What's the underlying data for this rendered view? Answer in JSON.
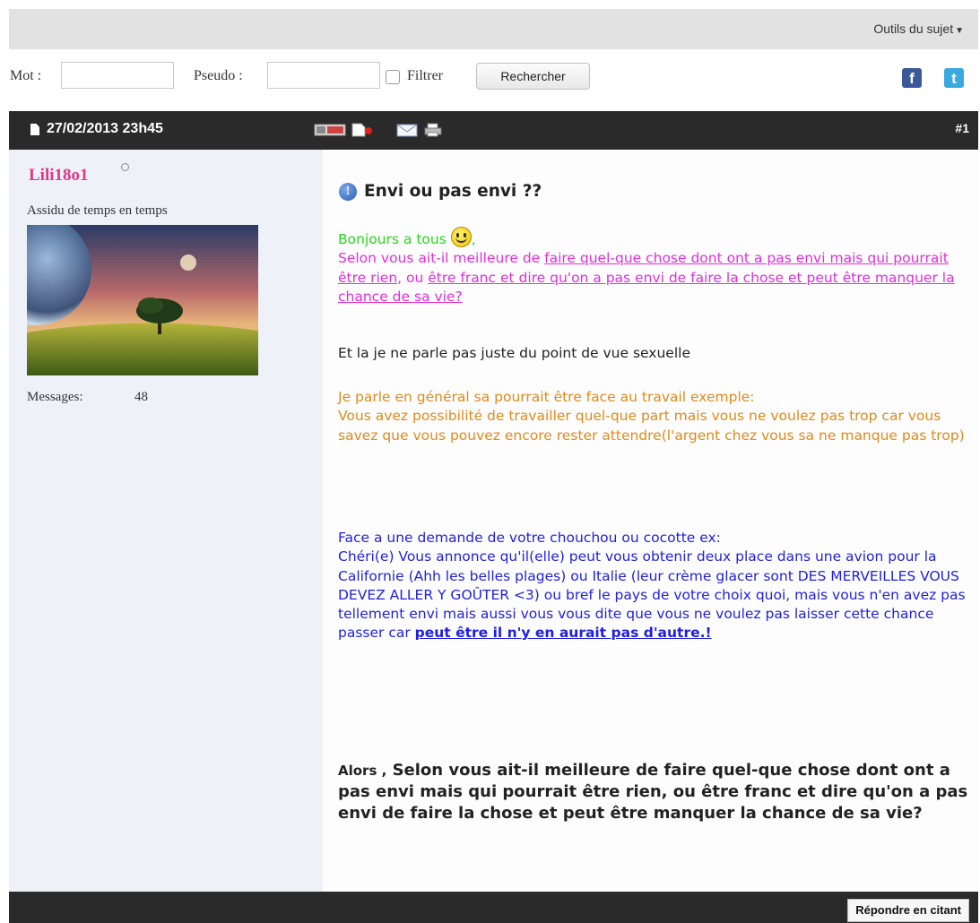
{
  "toolbar": {
    "tools_label": "Outils du sujet"
  },
  "search": {
    "word_label": "Mot :",
    "pseudo_label": "Pseudo :",
    "filter_label": "Filtrer",
    "search_button": "Rechercher"
  },
  "social": {
    "facebook": "f",
    "twitter": "t"
  },
  "post": {
    "date": "27/02/2013 23h45",
    "number": "#1",
    "author": {
      "name": "Lili18o1",
      "rank": "Assidu de temps en temps",
      "messages_label": "Messages:",
      "messages_count": "48"
    },
    "title": "Envi ou pas envi ??",
    "greeting": "Bonjours a tous",
    "greeting_suffix": ",",
    "q1_lead": "Selon vous ait-il meilleure de ",
    "q1_link1": "faire quel-que chose dont ont a pas envi mais qui pourrait être rien",
    "q1_mid": ", ou ",
    "q1_link2": "être franc et dire qu'on a pas envi de faire la chose et peut être manquer la chance de sa vie?",
    "not_sexual": "Et la je ne parle pas juste du point de vue sexuelle",
    "work_line1": "Je parle en général sa pourrait être face au travail exemple:",
    "work_line2": "Vous avez possibilité de travailler quel-que part mais vous ne voulez pas trop car vous savez que vous pouvez encore rester attendre(l'argent chez vous sa ne manque pas trop)",
    "partner_line1": "Face a une demande de votre chouchou ou cocotte ex:",
    "partner_line2": "Chéri(e) Vous annonce qu'il(elle) peut vous obtenir deux place dans une avion pour la Californie (Ahh les belles plages) ou Italie (leur crème glacer sont DES MERVEILLES VOUS DEVEZ ALLER Y GOÛTER <3) ou bref le pays de votre choix quoi, mais vous n'en avez pas tellement envi mais aussi vous vous dite que vous ne voulez pas laisser cette chance passer car ",
    "partner_link": "peut être il n'y en aurait pas d'autre.!",
    "final_lead": "Alors ,",
    "final_question": " Selon vous ait-il meilleure de faire quel-que chose dont ont a pas envi mais qui pourrait être rien, ou être franc et dire qu'on a pas envi de faire la chose et peut être manquer la chance de sa vie?"
  },
  "footer": {
    "reply_quote": "Répondre en citant"
  },
  "colors": {
    "header_bg": "#2a2a2a",
    "username": "#e1378a",
    "green_text": "#26d91c",
    "magenta_text": "#e22ee0",
    "orange_text": "#e08a19",
    "blue_text": "#1f1fdf",
    "facebook": "#3b5998",
    "twitter": "#3aa9e0"
  },
  "icons": [
    "caret-down-icon",
    "facebook-icon",
    "twitter-icon",
    "document-icon",
    "pm-icon",
    "pdf-icon",
    "email-icon",
    "print-icon",
    "info-icon",
    "smiley-icon",
    "online-status-icon"
  ]
}
